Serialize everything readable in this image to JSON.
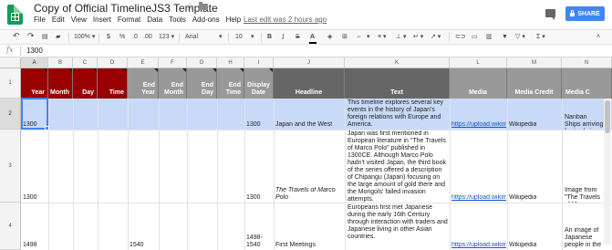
{
  "header": {
    "title": "Copy of Official TimelineJS3 Template",
    "last_edit": "Last edit was 2 hours ago",
    "share_label": "SHARE"
  },
  "menu": [
    "File",
    "Edit",
    "View",
    "Insert",
    "Format",
    "Data",
    "Tools",
    "Add-ons",
    "Help"
  ],
  "toolbar": {
    "zoom": "100%",
    "currency": "$",
    "percent": "%",
    "dec_less": ".0",
    "dec_more": ".00",
    "more_formats": "123",
    "font": "Arial",
    "font_size": "10",
    "bold": "B",
    "italic": "I",
    "strike": "S",
    "text_color": "A"
  },
  "formula": {
    "fx": "fx",
    "value": "1300"
  },
  "columns": [
    "A",
    "B",
    "C",
    "D",
    "E",
    "F",
    "G",
    "H",
    "I",
    "J",
    "K",
    "L",
    "M",
    "N"
  ],
  "headers": [
    "Year",
    "Month",
    "Day",
    "Time",
    "End Year",
    "End Month",
    "End Day",
    "End Time",
    "Display Date",
    "Headline",
    "Text",
    "Media",
    "Media Credit",
    "Media C"
  ],
  "rows": [
    {
      "num": "1"
    },
    {
      "num": "2",
      "year": "1300",
      "display_date": "1300",
      "headline": "Japan and the West",
      "text": "This timeline explores several key events in the history of Japan's foreign relations with Europe and America.",
      "media": "https://upload.wikimedia.org/wikipedia",
      "credit": "Wikipedia",
      "caption": "Nanban Ships arriving for trade in Japan"
    },
    {
      "num": "3",
      "year": "1300",
      "display_date": "1300",
      "headline": "The Travels of Marco Polo",
      "text": "Japan was first mentioned in European literature in \"The Travels of Marco Polo\" published in 1300CE. Although Marco Polo hadn't visited Japan, the third book of the series offered a description of Chipangu (Japan) focusing on the large amount of gold there and the Mongols' failed invasion attempts.",
      "media": "https://upload.wikimedia.org/wikipedia",
      "credit": "Wikipedia",
      "caption": "Image from \"The Travels of Marco Polo.\""
    },
    {
      "num": "4",
      "year": "1498",
      "end_year": "1540",
      "display_date": "1498-1540",
      "headline": "First Meetings",
      "text": "Europeans first met Japanese during the early 16th Century through interaction with traders and Japanese living in other Asian countries.",
      "media": "https://upload.wikimedia.org/wikipedia",
      "credit": "Wikipedia",
      "caption": "An image of Japanese people in the period of ship used by Japanese in the period."
    }
  ],
  "colors": {
    "header_red": "#990000",
    "header_gray": "#999999",
    "header_dark_gray": "#666666",
    "selection": "#c9daf8",
    "share_blue": "#4285f4",
    "link": "#1155cc"
  }
}
